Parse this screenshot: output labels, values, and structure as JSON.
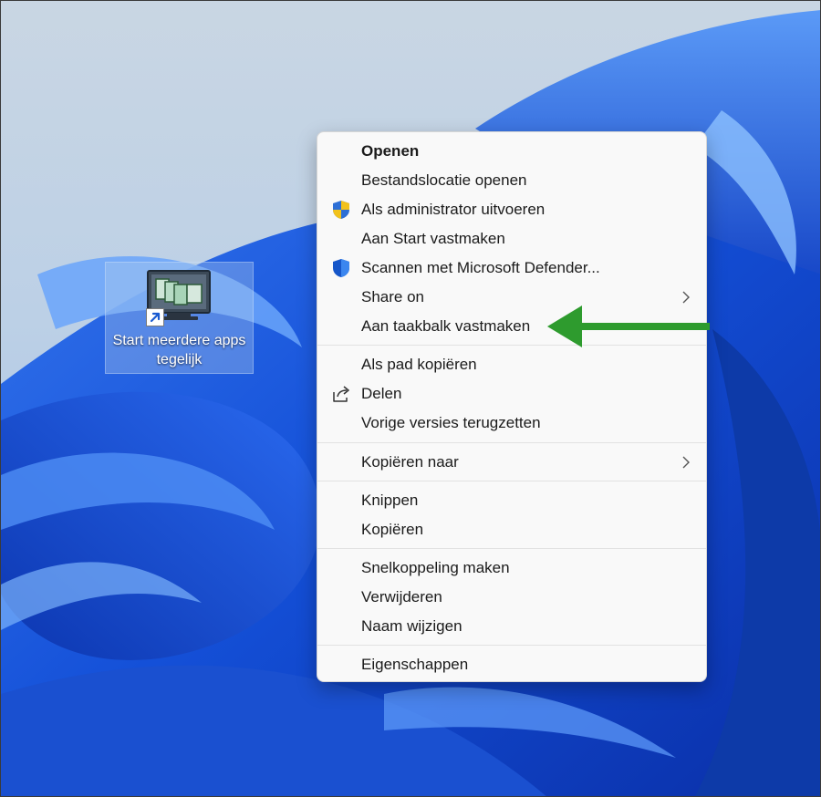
{
  "desktop": {
    "shortcut": {
      "label_line1": "Start meerdere apps",
      "label_line2": "tegelijk"
    }
  },
  "menu": {
    "group1": [
      {
        "label": "Openen",
        "bold": true
      },
      {
        "label": "Bestandslocatie openen"
      },
      {
        "label": "Als administrator uitvoeren",
        "icon": "uac-shield-icon"
      },
      {
        "label": "Aan Start vastmaken"
      },
      {
        "label": "Scannen met Microsoft Defender...",
        "icon": "defender-shield-icon"
      },
      {
        "label": "Share on",
        "submenu": true
      },
      {
        "label": "Aan taakbalk vastmaken"
      }
    ],
    "group2": [
      {
        "label": "Als pad kopiëren"
      },
      {
        "label": "Delen",
        "icon": "share-icon"
      },
      {
        "label": "Vorige versies terugzetten"
      }
    ],
    "group3": [
      {
        "label": "Kopiëren naar",
        "submenu": true
      }
    ],
    "group4": [
      {
        "label": "Knippen"
      },
      {
        "label": "Kopiëren"
      }
    ],
    "group5": [
      {
        "label": "Snelkoppeling maken"
      },
      {
        "label": "Verwijderen"
      },
      {
        "label": "Naam wijzigen"
      }
    ],
    "group6": [
      {
        "label": "Eigenschappen"
      }
    ]
  },
  "colors": {
    "annotation_arrow": "#2e9b2e",
    "wallpaper_blue": "#1f5fe0"
  }
}
